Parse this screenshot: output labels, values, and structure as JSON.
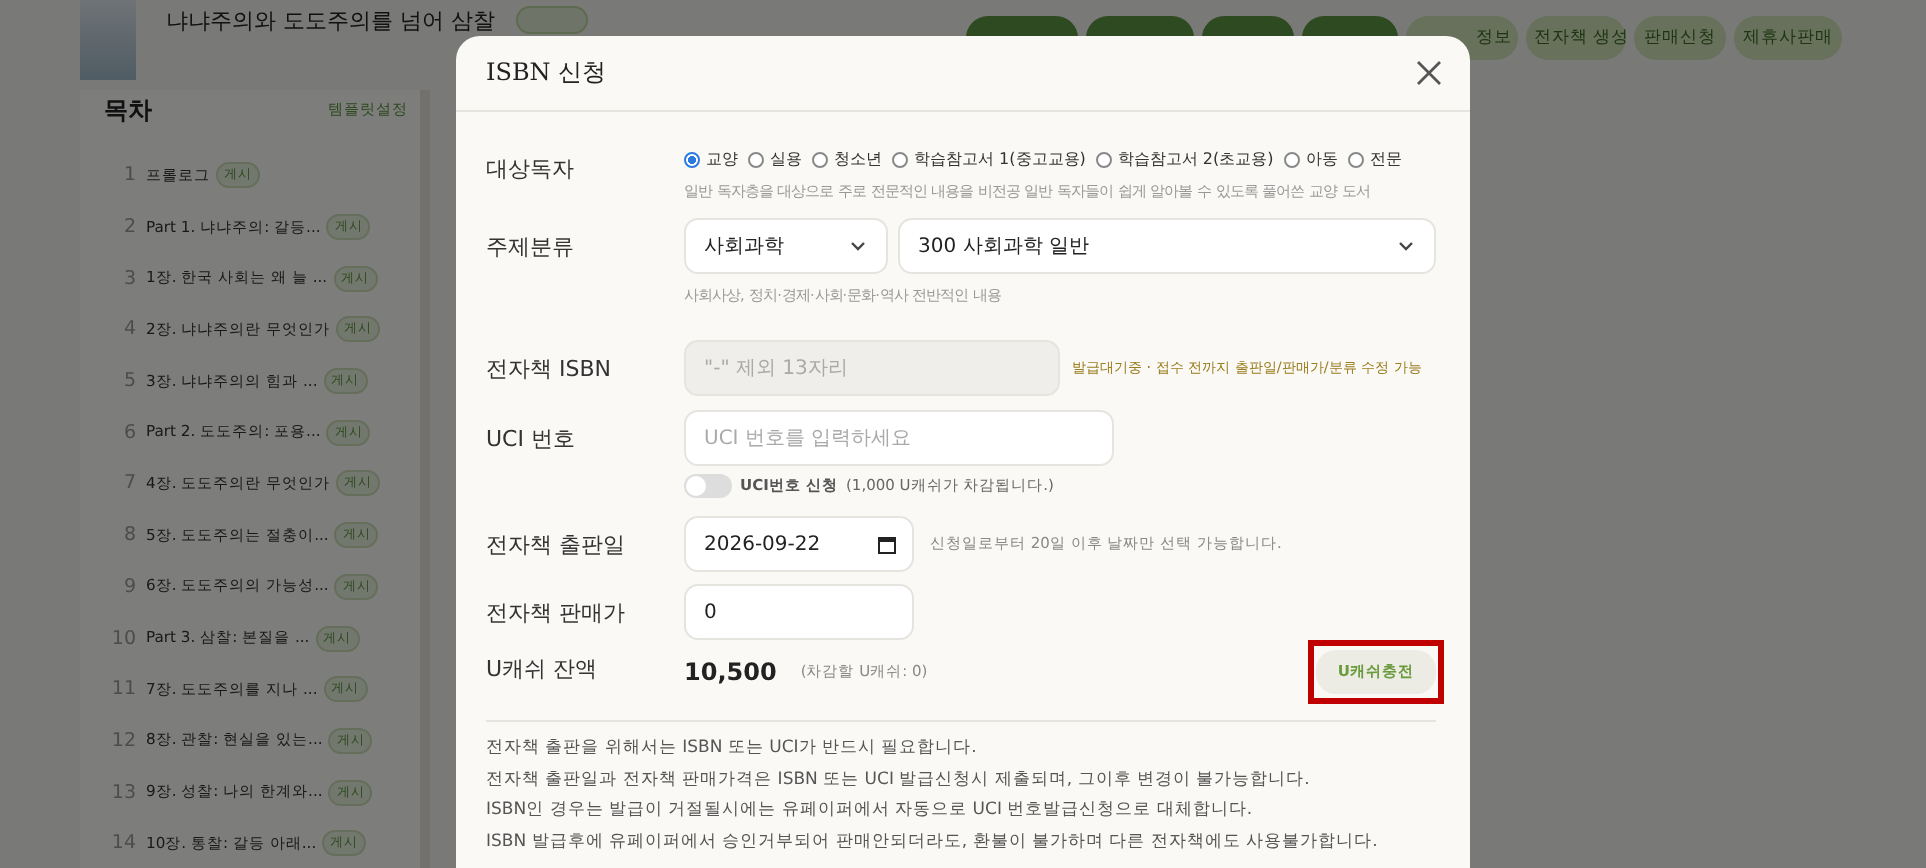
{
  "header": {
    "book_title": "냐냐주의와 도도주의를 넘어 삼찰",
    "actions": [
      {
        "kind": "primary"
      },
      {
        "kind": "primary"
      },
      {
        "kind": "primary"
      },
      {
        "kind": "primary"
      },
      {
        "label": "정보",
        "kind": "secondary"
      },
      {
        "label": "전자책 생성",
        "kind": "secondary"
      },
      {
        "label": "판매신청",
        "kind": "secondary"
      },
      {
        "label": "제휴사판매",
        "kind": "secondary"
      }
    ]
  },
  "toc": {
    "title": "목차",
    "template_link": "템플릿설정",
    "items": [
      {
        "number": "1",
        "title": "프롤로그",
        "badge": "게시"
      },
      {
        "number": "2",
        "title": "Part 1. 냐냐주의: 갈등...",
        "badge": "게시"
      },
      {
        "number": "3",
        "title": "1장. 한국 사회는 왜 늘 ...",
        "badge": "게시"
      },
      {
        "number": "4",
        "title": "2장. 냐냐주의란 무엇인가",
        "badge": "게시"
      },
      {
        "number": "5",
        "title": "3장. 냐냐주의의 힘과 ...",
        "badge": "게시"
      },
      {
        "number": "6",
        "title": "Part 2. 도도주의: 포용...",
        "badge": "게시"
      },
      {
        "number": "7",
        "title": "4장. 도도주의란 무엇인가",
        "badge": "게시"
      },
      {
        "number": "8",
        "title": "5장. 도도주의는 절충이...",
        "badge": "게시"
      },
      {
        "number": "9",
        "title": "6장. 도도주의의 가능성...",
        "badge": "게시"
      },
      {
        "number": "10",
        "title": "Part 3. 삼찰: 본질을 ...",
        "badge": "게시"
      },
      {
        "number": "11",
        "title": "7장. 도도주의를 지나 ...",
        "badge": "게시"
      },
      {
        "number": "12",
        "title": "8장. 관찰: 현실을 있는...",
        "badge": "게시"
      },
      {
        "number": "13",
        "title": "9장. 성찰: 나의 한계와...",
        "badge": "게시"
      },
      {
        "number": "14",
        "title": "10장. 통찰: 갈등 아래...",
        "badge": "게시"
      }
    ]
  },
  "dialog": {
    "title": "ISBN 신청",
    "audience": {
      "label": "대상독자",
      "options": [
        {
          "label": "교양",
          "selected": true
        },
        {
          "label": "실용",
          "selected": false
        },
        {
          "label": "청소년",
          "selected": false
        },
        {
          "label": "학습참고서 1(중고교용)",
          "selected": false
        },
        {
          "label": "학습참고서 2(초교용)",
          "selected": false
        },
        {
          "label": "아동",
          "selected": false
        },
        {
          "label": "전문",
          "selected": false
        }
      ],
      "hint": "일반 독자층을 대상으로 주로 전문적인 내용을 비전공 일반 독자들이 쉽게 알아볼 수 있도록 풀어쓴 교양 도서"
    },
    "subject": {
      "label": "주제분류",
      "category": "사회과학",
      "subcategory": "300 사회과학 일반",
      "hint": "사회사상, 정치·경제·사회·문화·역사 전반적인 내용"
    },
    "isbn": {
      "label": "전자책 ISBN",
      "placeholder": "\"-\" 제외 13자리",
      "disabled": true,
      "status": "발급대기중 · 접수 전까지 출판일/판매가/분류 수정 가능"
    },
    "uci": {
      "label": "UCI 번호",
      "placeholder": "UCI 번호를 입력하세요",
      "toggle": {
        "on": false,
        "label": "UCI번호 신청",
        "note": "(1,000 U캐쉬가 차감됩니다.)"
      }
    },
    "pub_date": {
      "label": "전자책 출판일",
      "value": "2026-09-22",
      "note": "신청일로부터 20일 이후 날짜만 선택 가능합니다."
    },
    "price": {
      "label": "전자책 판매가",
      "value": "0"
    },
    "balance": {
      "label": "U캐쉬 잔액",
      "amount": "10,500",
      "deduct": "(차감할 U캐쉬: 0)",
      "charge_button": "U캐쉬충전",
      "highlighted": true
    },
    "notices": [
      "전자책 출판을 위해서는 ISBN 또는 UCI가 반드시 필요합니다.",
      "전자책 출판일과 전자책 판매가격은 ISBN 또는 UCI 발급신청시 제출되며, 그이후 변경이 불가능합니다.",
      "ISBN인 경우는 발급이 거절될시에는 유페이퍼에서 자동으로 UCI 번호발급신청으로 대체합니다.",
      "ISBN 발급후에 유페이퍼에서 승인거부되어 판매안되더라도, 환불이 불가하며 다른 전자책에도 사용불가합니다."
    ]
  }
}
